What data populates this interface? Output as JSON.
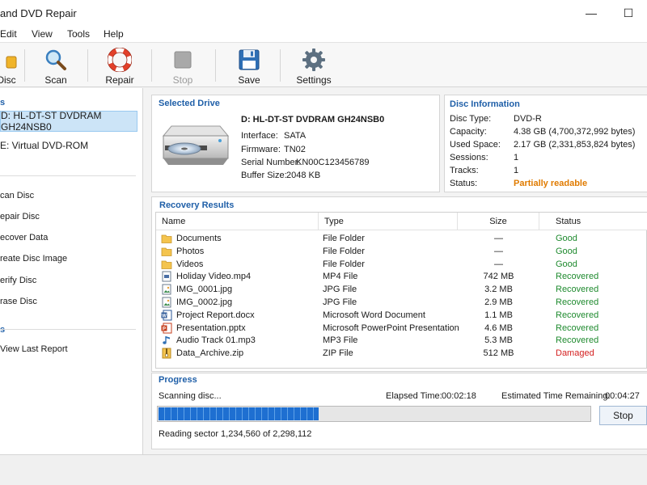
{
  "window": {
    "title": "and DVD Repair",
    "minimize_glyph": "—",
    "maximize_glyph": "☐"
  },
  "menu": [
    "Edit",
    "View",
    "Tools",
    "Help"
  ],
  "toolbar": {
    "items": [
      {
        "label": "Disc",
        "icon": "disc-icon",
        "enabled": true
      },
      {
        "label": "Scan",
        "icon": "magnifier-icon",
        "enabled": true
      },
      {
        "label": "Repair",
        "icon": "lifebuoy-icon",
        "enabled": true
      },
      {
        "label": "Stop",
        "icon": "stop-icon",
        "enabled": false
      },
      {
        "label": "Save",
        "icon": "floppy-icon",
        "enabled": true
      },
      {
        "label": "Settings",
        "icon": "gear-icon",
        "enabled": true
      }
    ]
  },
  "sidebar": {
    "section1_head": "s",
    "drives": [
      {
        "label": "D: HL-DT-ST DVDRAM GH24NSB0",
        "selected": true
      },
      {
        "label": "E: Virtual DVD-ROM",
        "selected": false
      }
    ],
    "tasks": [
      "can Disc",
      "epair Disc",
      "ecover Data",
      "reate Disc Image",
      "erify Disc",
      "rase Disc"
    ],
    "section3_head": "s",
    "reports": [
      "View Last Report"
    ]
  },
  "selected_drive": {
    "title": "Selected Drive",
    "name": "D: HL-DT-ST DVDRAM GH24NSB0",
    "fields": [
      {
        "label": "Interface:",
        "value": "SATA"
      },
      {
        "label": "Firmware:",
        "value": "TN02"
      },
      {
        "label": "Serial Number:",
        "value": "KN00C123456789"
      },
      {
        "label": "Buffer Size:",
        "value": "2048 KB"
      }
    ]
  },
  "disc_info": {
    "title": "Disc Information",
    "fields": [
      {
        "label": "Disc Type:",
        "value": "DVD-R"
      },
      {
        "label": "Capacity:",
        "value": "4.38 GB (4,700,372,992 bytes)"
      },
      {
        "label": "Used Space:",
        "value": "2.17 GB (2,331,853,824 bytes)"
      },
      {
        "label": "Sessions:",
        "value": "1"
      },
      {
        "label": "Tracks:",
        "value": "1"
      },
      {
        "label": "Status:",
        "value": "Partially readable"
      }
    ],
    "status_color": "#e07b00"
  },
  "results": {
    "title": "Recovery Results",
    "columns": [
      "Name",
      "Type",
      "Size",
      "Status"
    ],
    "rows": [
      {
        "name": "Documents",
        "type": "File Folder",
        "size": "—",
        "status": "Good",
        "icon": "folder-icon"
      },
      {
        "name": "Photos",
        "type": "File Folder",
        "size": "—",
        "status": "Good",
        "icon": "folder-icon"
      },
      {
        "name": "Videos",
        "type": "File Folder",
        "size": "—",
        "status": "Good",
        "icon": "folder-icon"
      },
      {
        "name": "Holiday Video.mp4",
        "type": "MP4 File",
        "size": "742 MB",
        "status": "Recovered",
        "icon": "video-file-icon"
      },
      {
        "name": "IMG_0001.jpg",
        "type": "JPG File",
        "size": "3.2 MB",
        "status": "Recovered",
        "icon": "image-file-icon"
      },
      {
        "name": "IMG_0002.jpg",
        "type": "JPG File",
        "size": "2.9 MB",
        "status": "Recovered",
        "icon": "image-file-icon"
      },
      {
        "name": "Project Report.docx",
        "type": "Microsoft Word Document",
        "size": "1.1 MB",
        "status": "Recovered",
        "icon": "word-file-icon"
      },
      {
        "name": "Presentation.pptx",
        "type": "Microsoft PowerPoint Presentation",
        "size": "4.6 MB",
        "status": "Recovered",
        "icon": "powerpoint-file-icon"
      },
      {
        "name": "Audio Track 01.mp3",
        "type": "MP3 File",
        "size": "5.3 MB",
        "status": "Recovered",
        "icon": "audio-file-icon"
      },
      {
        "name": "Data_Archive.zip",
        "type": "ZIP File",
        "size": "512 MB",
        "status": "Damaged",
        "icon": "zip-file-icon"
      }
    ],
    "status_colors": {
      "Good": "#1e8a2e",
      "Recovered": "#1e8a2e",
      "Damaged": "#d42020"
    }
  },
  "progress": {
    "title": "Progress",
    "status_text": "Scanning disc...",
    "elapsed_label": "Elapsed Time:",
    "elapsed": "00:02:18",
    "remaining_label": "Estimated Time Remaining:",
    "remaining": "00:04:27",
    "fraction": 0.37,
    "stop_label": "Stop",
    "sector_text": "Reading sector 1,234,560 of 2,298,112"
  }
}
